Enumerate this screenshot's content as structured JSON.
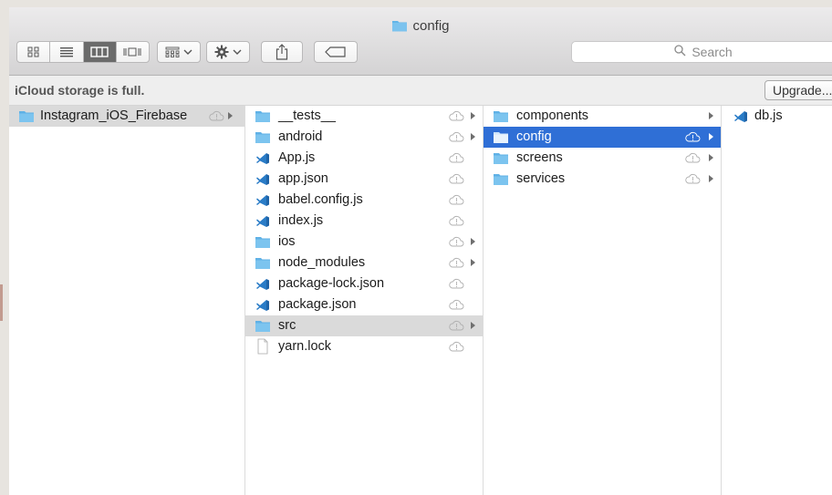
{
  "window": {
    "title": "config"
  },
  "toolbar": {
    "view_buttons": [
      "icon-view-icon",
      "list-view-icon",
      "column-view-icon",
      "gallery-view-icon"
    ],
    "search_placeholder": "Search"
  },
  "banner": {
    "message": "iCloud storage is full.",
    "upgrade_label": "Upgrade..."
  },
  "columns": [
    {
      "items": [
        {
          "name": "Instagram_iOS_Firebase",
          "kind": "folder",
          "cloud": true,
          "arrow": true,
          "selected": "grey"
        }
      ]
    },
    {
      "items": [
        {
          "name": "__tests__",
          "kind": "folder",
          "cloud": true,
          "arrow": true
        },
        {
          "name": "android",
          "kind": "folder",
          "cloud": true,
          "arrow": true
        },
        {
          "name": "App.js",
          "kind": "vscode",
          "cloud": true,
          "arrow": false
        },
        {
          "name": "app.json",
          "kind": "vscode",
          "cloud": true,
          "arrow": false
        },
        {
          "name": "babel.config.js",
          "kind": "vscode",
          "cloud": true,
          "arrow": false
        },
        {
          "name": "index.js",
          "kind": "vscode",
          "cloud": true,
          "arrow": false
        },
        {
          "name": "ios",
          "kind": "folder",
          "cloud": true,
          "arrow": true
        },
        {
          "name": "node_modules",
          "kind": "folder",
          "cloud": true,
          "arrow": true
        },
        {
          "name": "package-lock.json",
          "kind": "vscode",
          "cloud": true,
          "arrow": false
        },
        {
          "name": "package.json",
          "kind": "vscode",
          "cloud": true,
          "arrow": false
        },
        {
          "name": "src",
          "kind": "folder",
          "cloud": true,
          "arrow": true,
          "selected": "grey"
        },
        {
          "name": "yarn.lock",
          "kind": "doc",
          "cloud": true,
          "arrow": false
        }
      ]
    },
    {
      "items": [
        {
          "name": "components",
          "kind": "folder",
          "cloud": false,
          "arrow": true
        },
        {
          "name": "config",
          "kind": "folder",
          "cloud": true,
          "arrow": true,
          "selected": "blue"
        },
        {
          "name": "screens",
          "kind": "folder",
          "cloud": true,
          "arrow": true
        },
        {
          "name": "services",
          "kind": "folder",
          "cloud": true,
          "arrow": true
        }
      ]
    },
    {
      "items": [
        {
          "name": "db.js",
          "kind": "vscode",
          "cloud": false,
          "arrow": false
        }
      ]
    }
  ],
  "colors": {
    "folder": "#63b5e8",
    "selection_blue": "#2f6fd6",
    "selection_grey": "#dadada",
    "vscode": "#2a7cc7"
  }
}
